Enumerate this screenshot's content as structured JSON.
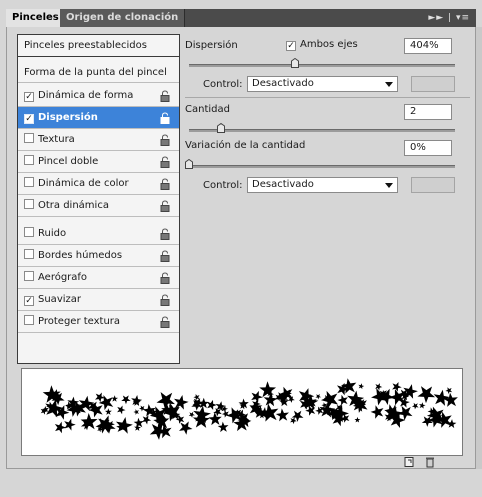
{
  "tabs": {
    "active": "Pinceles",
    "inactive": "Origen de clonación",
    "panel_icons": "►► | ▾≡"
  },
  "left": {
    "preset_button": "Pinceles preestablecidos",
    "tip_shape": "Forma de la punta del pincel",
    "items": [
      {
        "label": "Dinámica de forma",
        "checked": true,
        "selected": false,
        "mark": "✓"
      },
      {
        "label": "Dispersión",
        "checked": true,
        "selected": true,
        "mark": "✓"
      },
      {
        "label": "Textura",
        "checked": false,
        "selected": false,
        "mark": ""
      },
      {
        "label": "Pincel doble",
        "checked": false,
        "selected": false,
        "mark": ""
      },
      {
        "label": "Dinámica de color",
        "checked": false,
        "selected": false,
        "mark": ""
      },
      {
        "label": "Otra dinámica",
        "checked": false,
        "selected": false,
        "mark": ""
      },
      {
        "label": "Ruido",
        "checked": false,
        "selected": false,
        "mark": ""
      },
      {
        "label": "Bordes húmedos",
        "checked": false,
        "selected": false,
        "mark": ""
      },
      {
        "label": "Aerógrafo",
        "checked": false,
        "selected": false,
        "mark": ""
      },
      {
        "label": "Suavizar",
        "checked": true,
        "selected": false,
        "mark": "✓"
      },
      {
        "label": "Proteger textura",
        "checked": false,
        "selected": false,
        "mark": ""
      }
    ]
  },
  "right": {
    "scatter_label": "Dispersión",
    "both_axes_label": "Ambos ejes",
    "both_axes_mark": "✓",
    "scatter_value": "404%",
    "scatter_level": 0.4,
    "control1_label": "Control:",
    "control1_value": "Desactivado",
    "count_label": "Cantidad",
    "count_value": "2",
    "count_level": 0.12,
    "count_jitter_label": "Variación de la cantidad",
    "count_jitter_value": "0%",
    "count_jitter_level": 0.0,
    "control2_label": "Control:",
    "control2_value": "Desactivado"
  },
  "icons": {
    "lock": "lock-icon",
    "new_preset": "new-brush-icon",
    "trash": "trash-icon"
  },
  "colors": {
    "selection": "#3d83d9",
    "tab_bar": "#4b4b4b"
  }
}
